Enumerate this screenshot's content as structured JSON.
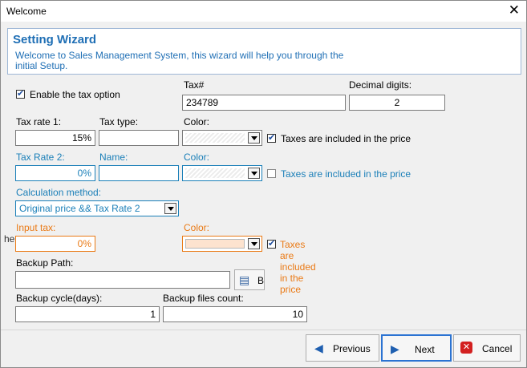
{
  "window": {
    "title": "Welcome",
    "close_glyph": "✕"
  },
  "header": {
    "title": "Setting Wizard",
    "description": "Welcome to  Sales Management System, this wizard will help you through the initial Setup."
  },
  "tax": {
    "enable_label": "Enable the tax option",
    "enable_checked": true,
    "tax_no_label": "Tax#",
    "tax_no_value": "234789",
    "decimal_label": "Decimal digits:",
    "decimal_value": "2"
  },
  "rate1": {
    "label": "Tax rate 1:",
    "value": "15%",
    "type_label": "Tax type:",
    "type_value": "",
    "color_label": "Color:",
    "included_label": "Taxes are included in the price",
    "included_checked": true
  },
  "rate2": {
    "label": "Tax Rate 2:",
    "value": "0%",
    "name_label": "Name:",
    "name_value": "",
    "color_label": "Color:",
    "included_label": "Taxes are included in the price",
    "included_checked": false
  },
  "calc": {
    "label": "Calculation method:",
    "value": "Original price && Tax Rate 2"
  },
  "input_tax": {
    "label": "Input tax:",
    "overlap_text": "he",
    "value": "0%",
    "color_label": "Color:",
    "included_label": "Taxes are included in the price",
    "included_checked": true
  },
  "backup": {
    "path_label": "Backup Path:",
    "path_value": "",
    "browse_label": "Br",
    "cycle_label": "Backup cycle(days):",
    "cycle_value": "1",
    "count_label": "Backup files count:",
    "count_value": "10"
  },
  "buttons": {
    "previous": "Previous",
    "next": "Next",
    "cancel": "Cancel"
  },
  "colors": {
    "accent_blue": "#1a7fb8",
    "accent_orange": "#ea7a16",
    "header_blue": "#1f6fb5"
  }
}
